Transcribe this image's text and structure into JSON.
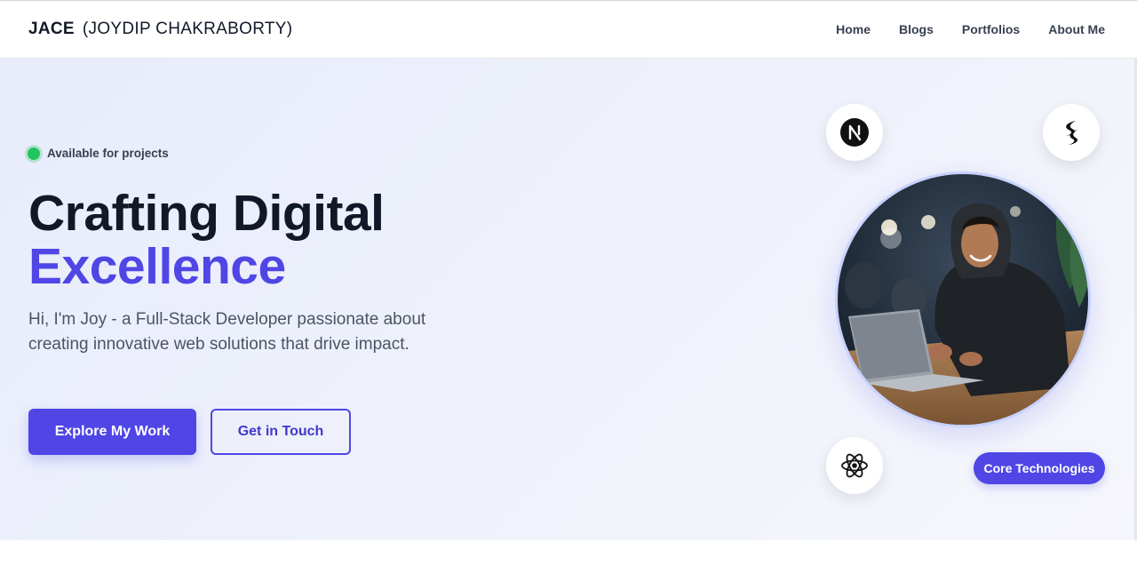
{
  "nav": {
    "brand_short": "JACE",
    "brand_full": "(JOYDIP CHAKRABORTY)",
    "links": [
      "Home",
      "Blogs",
      "Portfolios",
      "About Me"
    ]
  },
  "hero": {
    "status_text": "Available for projects",
    "headline_line1": "Crafting Digital",
    "headline_line2": "Excellence",
    "subtitle": "Hi, I'm Joy - a Full-Stack Developer passionate about creating innovative web solutions that drive impact.",
    "primary_button": "Explore My Work",
    "secondary_button": "Get in Touch",
    "tech_badge": "Core Technologies",
    "tech_icons": [
      "nextjs-icon",
      "tailwind-icon",
      "react-icon"
    ],
    "portrait": "developer-portrait"
  },
  "colors": {
    "accent": "#4f46e5",
    "status": "#22c55e",
    "text": "#111827",
    "muted": "#4b5563"
  }
}
